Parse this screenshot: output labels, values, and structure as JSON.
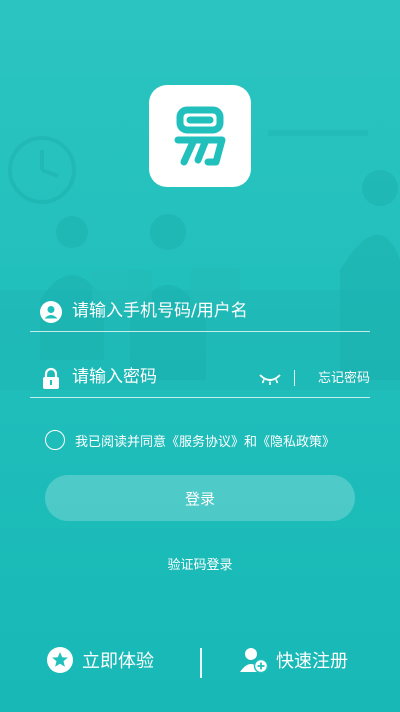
{
  "logo": {
    "icon": "yi-character-logo",
    "color": "#22c0bd"
  },
  "login_form": {
    "username_placeholder": "请输入手机号码/用户名",
    "password_placeholder": "请输入密码",
    "forgot_password": "忘记密码"
  },
  "agreement": {
    "prefix": "我已阅读并同意",
    "service_link": "《服务协议》",
    "conjunction": "和",
    "privacy_link": "《隐私政策》"
  },
  "login_button": "登录",
  "sms_login": "验证码登录",
  "bottom": {
    "experience_label": "立即体验",
    "register_label": "快速注册"
  },
  "colors": {
    "background": "#22c0bd",
    "text": "#ffffff"
  }
}
